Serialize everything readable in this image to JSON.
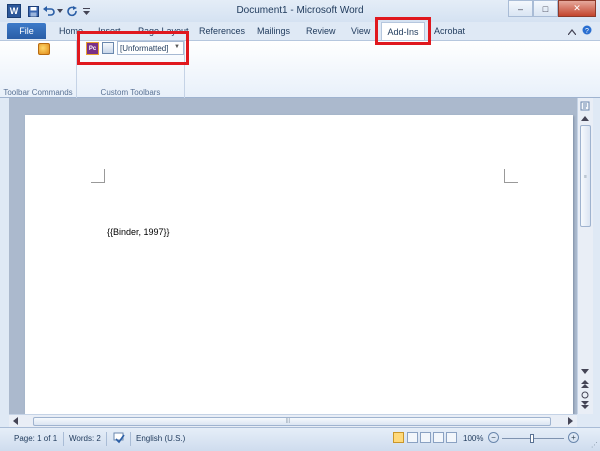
{
  "window": {
    "title": "Document1 - Microsoft Word",
    "word_icon_letter": "W",
    "buttons": {
      "minimize": "–",
      "maximize": "□",
      "close": "✕"
    }
  },
  "quick_access": {
    "save_icon": "save-icon",
    "undo_icon": "undo-icon",
    "redo_icon": "redo-icon",
    "customize_icon": "customize-icon"
  },
  "tabs": [
    {
      "label": "File",
      "active": false
    },
    {
      "label": "Home",
      "active": false
    },
    {
      "label": "Insert",
      "active": false
    },
    {
      "label": "Page Layout",
      "active": false
    },
    {
      "label": "References",
      "active": false
    },
    {
      "label": "Mailings",
      "active": false
    },
    {
      "label": "Review",
      "active": false
    },
    {
      "label": "View",
      "active": false
    },
    {
      "label": "Add-Ins",
      "active": true
    },
    {
      "label": "Acrobat",
      "active": false
    }
  ],
  "ribbon": {
    "groups": [
      {
        "label": "Toolbar Commands"
      },
      {
        "label": "Custom Toolbars"
      }
    ],
    "pc_icon_text": "Pc",
    "style_combo": "[Unformatted]",
    "combo_arrow": "▼"
  },
  "document": {
    "text": "{{Binder, 1997}}"
  },
  "statusbar": {
    "page": "Page: 1 of 1",
    "words": "Words: 2",
    "language": "English (U.S.)",
    "zoom": "100%",
    "zoom_out": "−",
    "zoom_in": "+"
  },
  "colors": {
    "accent": "#2b579a",
    "highlight": "#e0181e",
    "file_tab": "#2a5ea6"
  }
}
